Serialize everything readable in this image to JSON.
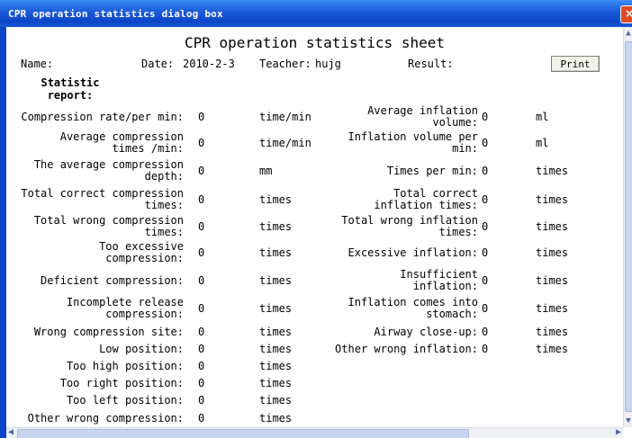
{
  "window": {
    "title": "CPR operation statistics dialog box",
    "close_glyph": "×"
  },
  "sheet": {
    "title": "CPR operation statistics sheet",
    "name_label": "Name:",
    "date_label": "Date:",
    "date_value": "2010-2-3",
    "teacher_label": "Teacher:",
    "teacher_value": "hujg",
    "result_label": "Result:",
    "print_label": "Print",
    "report_title_1": "Statistic",
    "report_title_2": "report:"
  },
  "left_stats": [
    {
      "label": [
        "Compression rate/per min:"
      ],
      "value": "0",
      "unit": "time/min"
    },
    {
      "label": [
        "Average compression",
        "times /min:"
      ],
      "value": "0",
      "unit": "time/min"
    },
    {
      "label": [
        "The average compression",
        "depth:"
      ],
      "value": "0",
      "unit": "mm"
    },
    {
      "label": [
        "Total correct compression",
        "times:"
      ],
      "value": "0",
      "unit": "times"
    },
    {
      "label": [
        "Total wrong compression",
        "times:"
      ],
      "value": "0",
      "unit": "times"
    },
    {
      "label": [
        "Too excessive",
        "compression:"
      ],
      "value": "0",
      "unit": "times"
    },
    {
      "label": [
        "Deficient compression:"
      ],
      "value": "0",
      "unit": "times"
    },
    {
      "label": [
        "Incomplete release",
        "compression:"
      ],
      "value": "0",
      "unit": "times"
    },
    {
      "label": [
        "Wrong compression site:"
      ],
      "value": "0",
      "unit": "times"
    },
    {
      "label": [
        "Low position:"
      ],
      "value": "0",
      "unit": "times"
    },
    {
      "label": [
        "Too high position:"
      ],
      "value": "0",
      "unit": "times"
    },
    {
      "label": [
        "Too right position:"
      ],
      "value": "0",
      "unit": "times"
    },
    {
      "label": [
        "Too left position:"
      ],
      "value": "0",
      "unit": "times"
    },
    {
      "label": [
        "Other wrong compression:"
      ],
      "value": "0",
      "unit": "times"
    }
  ],
  "right_stats": [
    {
      "label": [
        "Average inflation",
        "volume:"
      ],
      "value": "0",
      "unit": "ml"
    },
    {
      "label": [
        "Inflation volume per",
        "min:"
      ],
      "value": "0",
      "unit": "ml"
    },
    {
      "label": [
        "Times per min:"
      ],
      "value": "0",
      "unit": "times"
    },
    {
      "label": [
        "Total correct",
        "inflation times:"
      ],
      "value": "0",
      "unit": "times"
    },
    {
      "label": [
        "Total wrong inflation",
        "times:"
      ],
      "value": "0",
      "unit": "times"
    },
    {
      "label": [
        "Excessive inflation:"
      ],
      "value": "0",
      "unit": "times"
    },
    {
      "label": [
        "Insufficient",
        "inflation:"
      ],
      "value": "0",
      "unit": "times"
    },
    {
      "label": [
        "Inflation comes into",
        "stomach:"
      ],
      "value": "0",
      "unit": "times"
    },
    {
      "label": [
        "Airway close-up:"
      ],
      "value": "0",
      "unit": "times"
    },
    {
      "label": [
        "Other wrong inflation:"
      ],
      "value": "0",
      "unit": "times"
    }
  ]
}
